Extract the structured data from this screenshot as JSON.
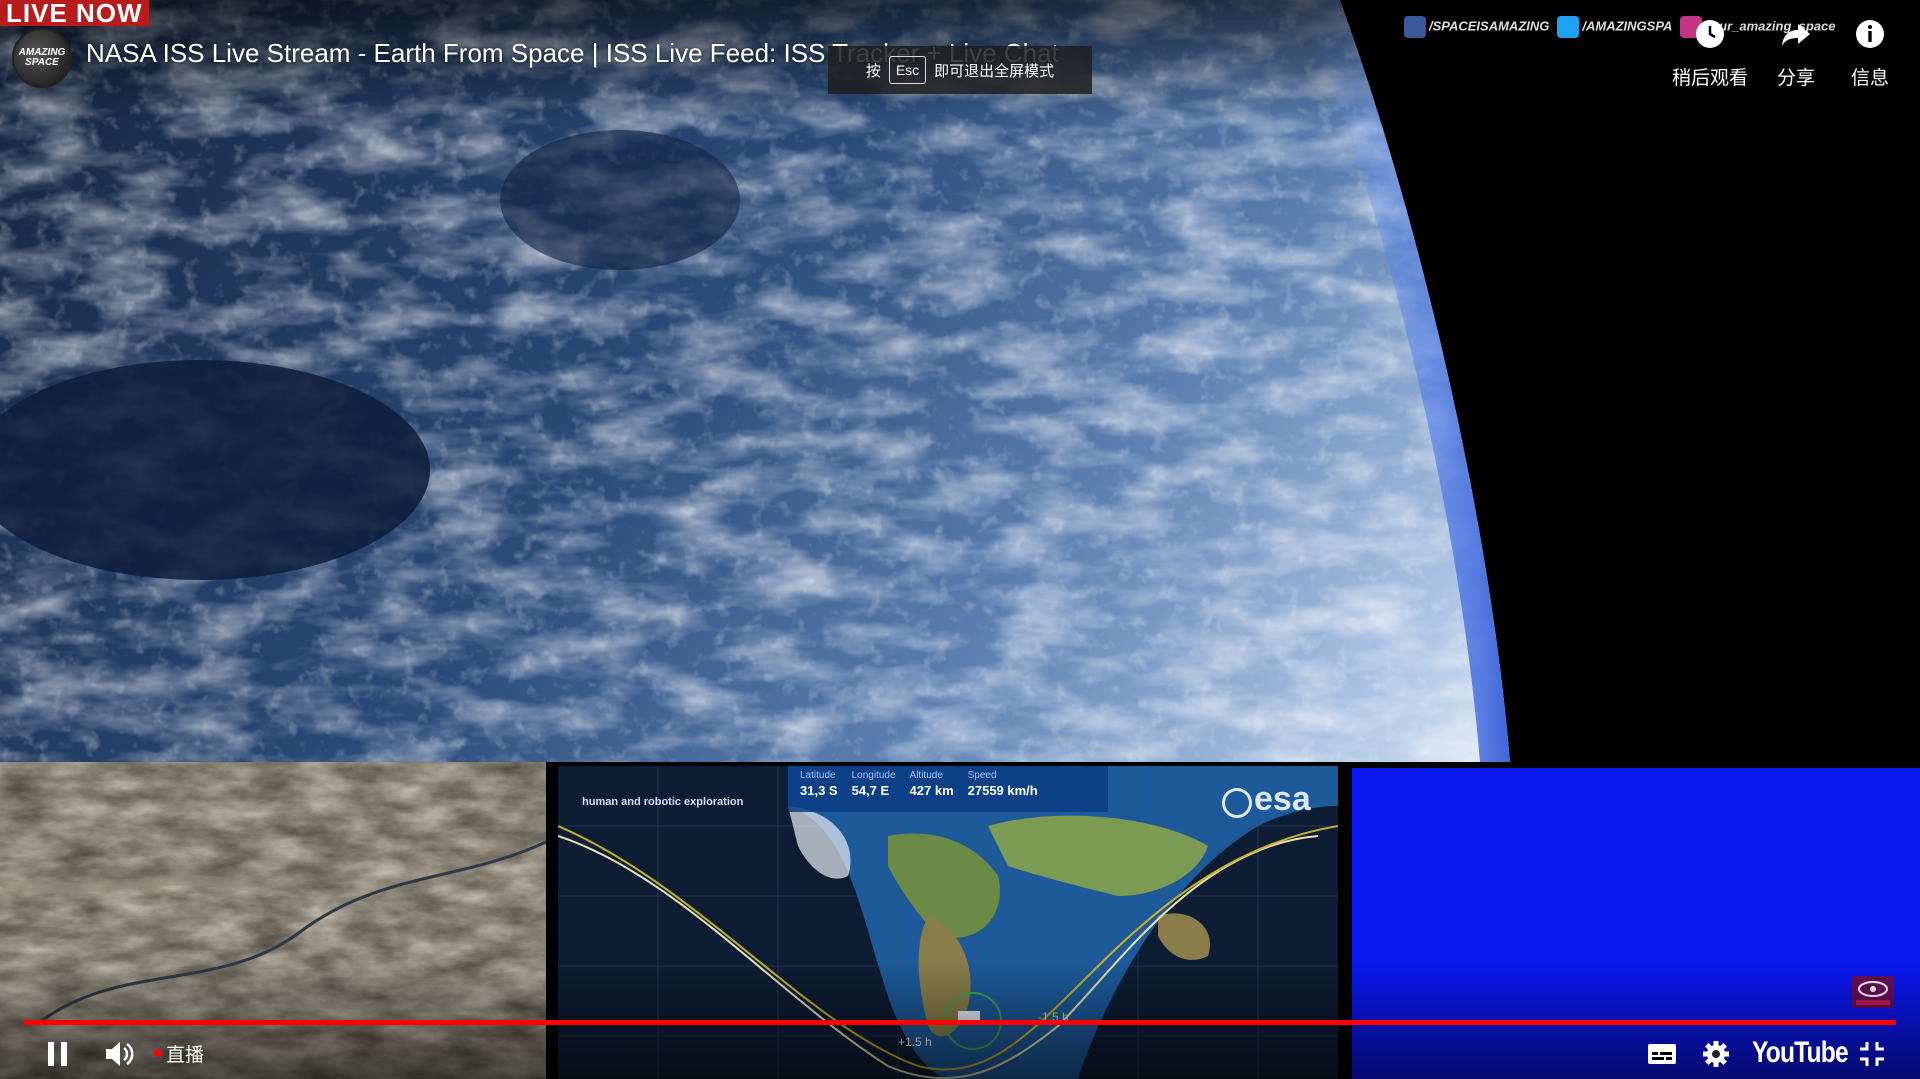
{
  "live_badge": "LIVE NOW",
  "channel": {
    "avatar_text": "AMAZING SPACE"
  },
  "video": {
    "title": "NASA ISS Live Stream - Earth From Space | ISS Live Feed: ISS Tracker + Live Chat"
  },
  "fullscreen_toast": {
    "prefix": "按",
    "key": "Esc",
    "suffix": "即可退出全屏模式"
  },
  "social_links": [
    {
      "icon": "facebook-icon",
      "text": "/SPACEISAMAZING",
      "color": "#3b5998"
    },
    {
      "icon": "twitter-icon",
      "text": "/AMAZINGSPA",
      "color": "#1da1f2"
    },
    {
      "icon": "instagram-icon",
      "text": "/Our_amazing_space",
      "color": "#c13584"
    }
  ],
  "top_buttons": {
    "watch_later": {
      "label": "稍后观看",
      "icon": "clock-icon"
    },
    "share": {
      "label": "分享",
      "icon": "share-arrow-icon"
    },
    "info": {
      "label": "信息",
      "icon": "info-icon"
    }
  },
  "tracker": {
    "subtitle": "human and robotic exploration",
    "brand": "esa",
    "stats": [
      {
        "key": "Latitude",
        "value": "31,3 S"
      },
      {
        "key": "Longitude",
        "value": "54,7 E"
      },
      {
        "key": "Altitude",
        "value": "427 km"
      },
      {
        "key": "Speed",
        "value": "27559 km/h"
      }
    ],
    "orbit_labels": [
      "+1.5 h",
      "-1.5 h"
    ]
  },
  "player": {
    "live_label": "直播",
    "progress": 1.0,
    "brand": "YouTube",
    "colors": {
      "progress": "#ff0000",
      "live_dot": "#ff0000",
      "blue_panel": "#0a17f0"
    },
    "icons": [
      "pause-icon",
      "volume-icon",
      "subtitles-icon",
      "settings-icon",
      "exit-fullscreen-icon"
    ]
  }
}
